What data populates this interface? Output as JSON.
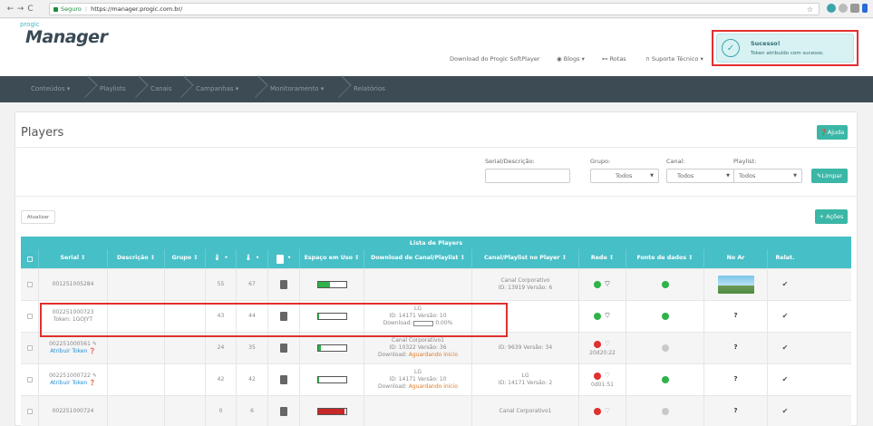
{
  "browser": {
    "secure_label": "Seguro",
    "url": "https://manager.progic.com.br/"
  },
  "logo": {
    "small": "progic",
    "big": "Manager"
  },
  "toplinks": {
    "download": "Download do Progic SoftPlayer",
    "blogs": "Blogs ▾",
    "rotas": "Rotas",
    "suporte": "Suporte Técnico ▾"
  },
  "nav": [
    "Conteúdos ▾",
    "Playlists",
    "Canais",
    "Campanhas ▾",
    "Monitoramento ▾",
    "Relatórios"
  ],
  "toast": {
    "title": "Sucesso!",
    "message": "Token atribuído com sucesso."
  },
  "page": {
    "title": "Players",
    "help_button": "Ajuda",
    "refresh_button": "Atualizar",
    "actions_button": "+ Ações",
    "clear_button": "Limpar"
  },
  "filters": {
    "serial_label": "Serial/Descrição:",
    "group_label": "Grupo:",
    "group_value": "Todos",
    "channel_label": "Canal:",
    "channel_value": "Todos",
    "playlist_label": "Playlist:",
    "playlist_value": "Todos"
  },
  "table": {
    "caption": "Lista de Players",
    "headers": {
      "serial": "Serial ↕",
      "descricao": "Descrição ↕",
      "grupo": "Grupo ↕",
      "temp": "•",
      "temp2": "•",
      "sd": "•",
      "espaco": "Espaço em Uso ↕",
      "download": "Download de Canal/Playlist ↕",
      "canal_player": "Canal/Playlist no Player ↕",
      "rede": "Rede ↕",
      "fonte": "Fonte de dados ↕",
      "noar": "No Ar",
      "relat": "Relat."
    },
    "rows": [
      {
        "serial": "001251005284",
        "serial2": "",
        "temp": "55",
        "temp2": "67",
        "usage": 0.45,
        "usage_color": "#2db34a",
        "download1": "",
        "download2": "",
        "download3": "",
        "player1": "Canal Corporativo",
        "player2": "ID: 13919  Versão: 6",
        "net": "green",
        "net_time": "",
        "fonte": "green",
        "noar": "thumb"
      },
      {
        "serial": "002251000723",
        "serial2": "Token: 1GOJYT",
        "temp": "43",
        "temp2": "44",
        "usage": 0.06,
        "usage_color": "#2db34a",
        "download1": "LG",
        "download2": "ID: 14171  Versão: 10",
        "download3": "0.00%",
        "download_prefix": "Download:",
        "player1": "",
        "player2": "",
        "net": "green",
        "net_time": "",
        "fonte": "green",
        "noar": "?"
      },
      {
        "serial": "002251000561",
        "serial2": "Atribuir Token",
        "temp": "24",
        "temp2": "35",
        "usage": 0.12,
        "usage_color": "#2db34a",
        "download1": "Canal Corporativo1",
        "download2": "ID: 10322  Versão: 36",
        "download3": "Aguardando início",
        "download_prefix": "Download:",
        "player1": "",
        "player2": "ID: 9639  Versão: 34",
        "net": "red",
        "net_time": "20d20:22",
        "fonte": "gray",
        "noar": "?"
      },
      {
        "serial": "002251000722",
        "serial2": "Atribuir Token",
        "temp": "42",
        "temp2": "42",
        "usage": 0.06,
        "usage_color": "#2db34a",
        "download1": "LG",
        "download2": "ID: 14171  Versão: 10",
        "download3": "Aguardando início",
        "download_prefix": "Download:",
        "player1": "LG",
        "player2": "ID: 14171  Versão: 2",
        "net": "red",
        "net_time": "0d01:51",
        "fonte": "green",
        "noar": "?"
      },
      {
        "serial": "002251000724",
        "serial2": "",
        "temp": "0",
        "temp2": "6",
        "usage": 0.95,
        "usage_color": "#c62828",
        "download1": "",
        "download2": "",
        "download3": "",
        "player1": "Canal Corporativo1",
        "player2": "",
        "net": "red",
        "net_time": "",
        "fonte": "gray",
        "noar": "?"
      }
    ]
  },
  "colors": {
    "accent": "#47bfc7",
    "button": "#3bb7a7",
    "navbar": "#3d4b54",
    "highlight": "#e0302f"
  }
}
